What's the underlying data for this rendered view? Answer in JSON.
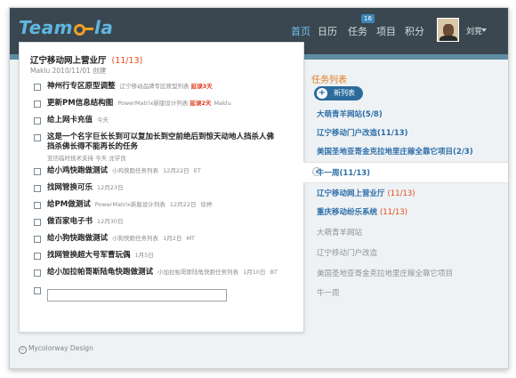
{
  "app": {
    "logo": "Teamola",
    "logo_prefix": "Team",
    "logo_suffix": "la"
  },
  "nav": {
    "items": [
      {
        "label": "首页",
        "active": true
      },
      {
        "label": "日历",
        "active": false
      },
      {
        "label": "任务",
        "active": false
      },
      {
        "label": "项目",
        "active": false
      },
      {
        "label": "积分",
        "active": false
      }
    ],
    "task_badge": "16"
  },
  "user": {
    "name": "刘竞"
  },
  "project": {
    "title": "辽宁移动网上营业厅",
    "count": "(11/13)",
    "meta": "Maklu   2010/11/01 创建"
  },
  "tasks": [
    {
      "title": "神州行专区原型调整",
      "list": "辽宁移动品牌专区原型列表",
      "late": "延误3天",
      "date": "",
      "owner": ""
    },
    {
      "title": "更新PM信息结构图",
      "list": "PowerMatrix新版设计列表",
      "late": "延误2天",
      "date": "",
      "owner": "Maklu"
    },
    {
      "title": "给上网卡充值",
      "list": "",
      "late": "",
      "date": "今天",
      "owner": ""
    },
    {
      "title": "这是一个名字巨长长到可以复加长到空前绝后到惊天动地人挡杀人佛挡杀佛长得不能再长的任务",
      "list": "亚信临时技术支持",
      "late": "",
      "date": "今天",
      "owner": "沈学良"
    },
    {
      "title": "给小鸡快跑做测试",
      "list": "小鸡快跑任务列表",
      "late": "",
      "date": "12月22日",
      "owner": "ET"
    },
    {
      "title": "找网管换可乐",
      "list": "",
      "late": "",
      "date": "12月23日",
      "owner": ""
    },
    {
      "title": "给PM做测试",
      "list": "PowerMatrix新版设计列表",
      "late": "",
      "date": "12月22日",
      "owner": "徐婷"
    },
    {
      "title": "做百家电子书",
      "list": "",
      "late": "",
      "date": "12月30日",
      "owner": ""
    },
    {
      "title": "给小狗快跑做测试",
      "list": "小狗快跑任务列表",
      "late": "",
      "date": "1月2日",
      "owner": "MT"
    },
    {
      "title": "找网管换超大号军曹玩偶",
      "list": "",
      "late": "",
      "date": "1月5日",
      "owner": ""
    },
    {
      "title": "给小加拉帕哥斯陆龟快跑做测试",
      "list": "小加拉帕哥斯陆龟快跑任务列表",
      "late": "",
      "date": "1月10日",
      "owner": "BT"
    }
  ],
  "new_task_input": {
    "value": "",
    "placeholder": ""
  },
  "sidebar": {
    "title": "任务列表",
    "new_button": "新列表",
    "items": [
      {
        "label": "大萌青羊网站",
        "count": "(5/8)",
        "style": "blue"
      },
      {
        "label": "辽宁移动门户改造",
        "count": "(11/13)",
        "style": "blue"
      },
      {
        "label": "美国圣地亚哥金克拉地里庄稼全靠它项目",
        "count": "(2/3)",
        "style": "blue"
      },
      {
        "label": "牛一周",
        "count": "(11/13)",
        "style": "active"
      },
      {
        "label": "辽宁移动网上营业厅",
        "count": "(11/13)",
        "style": "blue-orange"
      },
      {
        "label": "重庆移动纷乐系统",
        "count": "(11/13)",
        "style": "blue-orange"
      },
      {
        "label": "大萌青羊网站",
        "count": "",
        "style": "gray"
      },
      {
        "label": "辽宁移动门户改造",
        "count": "",
        "style": "gray"
      },
      {
        "label": "美国圣地亚哥金克拉地里庄稼全靠它项目",
        "count": "",
        "style": "gray"
      },
      {
        "label": "牛一周",
        "count": "",
        "style": "gray"
      }
    ]
  },
  "footer": {
    "text": "Mycolorway Design",
    "symbol": "c"
  },
  "colors": {
    "accent": "#2b6ca8",
    "alert": "#e24a1a",
    "header": "#3a4750"
  }
}
